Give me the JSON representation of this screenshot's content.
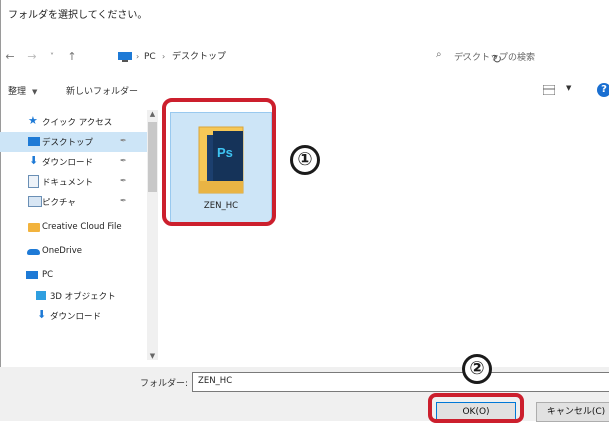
{
  "dialog": {
    "title": "フォルダを選択してください。"
  },
  "nav": {
    "back": "←",
    "forward": "→",
    "recent": "˅",
    "up": "↑",
    "breadcrumb": [
      "PC",
      "デスクトップ"
    ],
    "search_placeholder": "デスクトップの検索"
  },
  "toolbar": {
    "organize_label": "整理",
    "new_folder_label": "新しいフォルダー"
  },
  "sidebar": {
    "items": [
      {
        "label": "クイック アクセス",
        "icon": "star-icon"
      },
      {
        "label": "デスクトップ",
        "icon": "desktop-icon",
        "selected": true,
        "pinned": true
      },
      {
        "label": "ダウンロード",
        "icon": "download-icon",
        "pinned": true
      },
      {
        "label": "ドキュメント",
        "icon": "document-icon",
        "pinned": true
      },
      {
        "label": "ピクチャ",
        "icon": "pictures-icon",
        "pinned": true
      },
      {
        "label": "Creative Cloud File",
        "icon": "creative-cloud-folder-icon"
      },
      {
        "label": "OneDrive",
        "icon": "onedrive-icon"
      },
      {
        "label": "PC",
        "icon": "pc-icon"
      },
      {
        "label": "3D オブジェクト",
        "icon": "3d-objects-icon"
      },
      {
        "label": "ダウンロード",
        "icon": "download-icon"
      }
    ]
  },
  "content": {
    "folders": [
      {
        "name": "ZEN_HC"
      }
    ]
  },
  "annotations": {
    "step1": "①",
    "step2": "②"
  },
  "bottom": {
    "folder_label": "フォルダー:",
    "folder_value": "ZEN_HC",
    "ok_label": "OK(O)",
    "cancel_label": "キャンセル(C)"
  },
  "colors": {
    "highlight": "#cc1f2d",
    "selected_bg": "#cde5f7",
    "accent": "#0078d7"
  }
}
